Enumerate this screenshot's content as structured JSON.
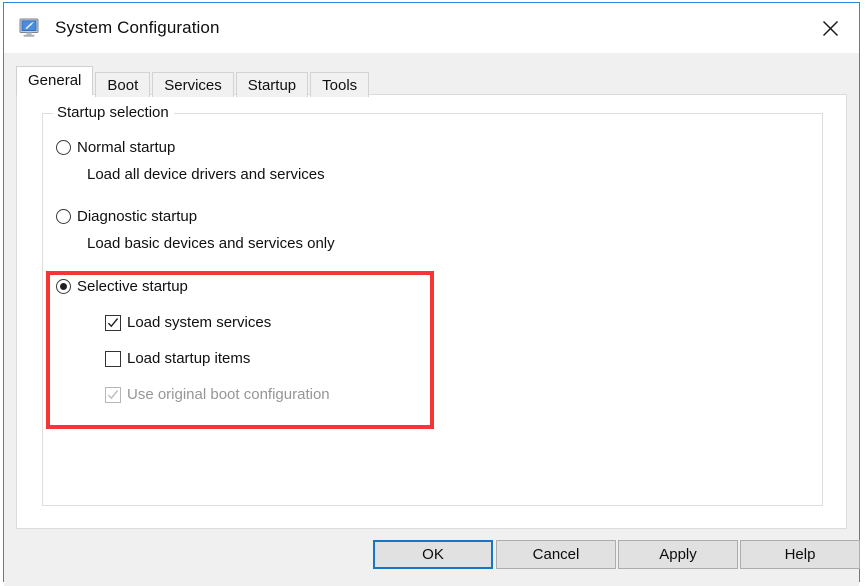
{
  "window": {
    "title": "System Configuration",
    "icon": "system-configuration-icon",
    "close_label": "×",
    "border_color": "#2a8ae0"
  },
  "tabs": [
    {
      "label": "General",
      "active": true
    },
    {
      "label": "Boot",
      "active": false
    },
    {
      "label": "Services",
      "active": false
    },
    {
      "label": "Startup",
      "active": false
    },
    {
      "label": "Tools",
      "active": false
    }
  ],
  "general": {
    "group_legend": "Startup selection",
    "options": [
      {
        "label": "Normal startup",
        "selected": false,
        "description": "Load all device drivers and services"
      },
      {
        "label": "Diagnostic startup",
        "selected": false,
        "description": "Load basic devices and services only"
      },
      {
        "label": "Selective startup",
        "selected": true,
        "description": ""
      }
    ],
    "checkboxes": [
      {
        "label": "Load system services",
        "checked": true,
        "disabled": false
      },
      {
        "label": "Load startup items",
        "checked": false,
        "disabled": false
      },
      {
        "label": "Use original boot configuration",
        "checked": true,
        "disabled": true
      }
    ]
  },
  "annotation": {
    "type": "highlight-rectangle",
    "color": "#f93434"
  },
  "footer": {
    "buttons": [
      {
        "label": "OK",
        "default": true
      },
      {
        "label": "Cancel",
        "default": false
      },
      {
        "label": "Apply",
        "default": false
      },
      {
        "label": "Help",
        "default": false
      }
    ]
  }
}
